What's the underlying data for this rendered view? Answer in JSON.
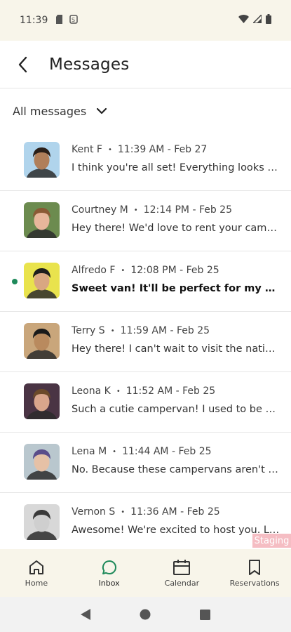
{
  "status_bar": {
    "time": "11:39",
    "icons": [
      "sd-card-icon",
      "sim-icon",
      "wifi-icon",
      "signal-icon",
      "battery-icon"
    ]
  },
  "app_bar": {
    "title": "Messages"
  },
  "filter": {
    "label": "All messages"
  },
  "messages": [
    {
      "name": "Kent F",
      "time": "11:39 AM - Feb 27",
      "preview": "I think you're all set! Everything looks go...",
      "unread": false,
      "avatar_bg": "#b0d4ec",
      "skin": "#b07f5a",
      "hair": "#2a1f18"
    },
    {
      "name": "Courtney M",
      "time": "12:14 PM - Feb 25",
      "preview": "Hey there! We'd love to rent your campe...",
      "unread": false,
      "avatar_bg": "#6c8b4f",
      "skin": "#e7b69b",
      "hair": "#8a5a35"
    },
    {
      "name": "Alfredo F",
      "time": "12:08 PM - Feb 25",
      "preview": "Sweet van! It'll be perfect for my and my...",
      "unread": true,
      "avatar_bg": "#e9e34d",
      "skin": "#d9a782",
      "hair": "#1d1d1d"
    },
    {
      "name": "Terry S",
      "time": "11:59 AM - Feb 25",
      "preview": "Hey there! I can't wait to visit the nationa...",
      "unread": false,
      "avatar_bg": "#c9a67b",
      "skin": "#b98a5e",
      "hair": "#1a1a1a"
    },
    {
      "name": "Leona K",
      "time": "11:52 AM - Feb 25",
      "preview": "Such a cutie campervan! I used to be a f...",
      "unread": false,
      "avatar_bg": "#4a3444",
      "skin": "#d9a68c",
      "hair": "#6b4a2a"
    },
    {
      "name": "Lena M",
      "time": "11:44 AM - Feb 25",
      "preview": "No. Because these campervans aren't m...",
      "unread": false,
      "avatar_bg": "#b9c7ce",
      "skin": "#e6c1a6",
      "hair": "#5b4d8a"
    },
    {
      "name": "Vernon S",
      "time": "11:36 AM - Feb 25",
      "preview": "Awesome! We're excited to host you. Let...",
      "unread": false,
      "avatar_bg": "#d8d8d8",
      "skin": "#cfcfcf",
      "hair": "#3a3a3a"
    }
  ],
  "staging_label": "Staging",
  "bottom_nav": [
    {
      "label": "Home",
      "icon": "home-icon",
      "active": false
    },
    {
      "label": "Inbox",
      "icon": "chat-bubble-icon",
      "active": true
    },
    {
      "label": "Calendar",
      "icon": "calendar-icon",
      "active": false
    },
    {
      "label": "Reservations",
      "icon": "bookmark-icon",
      "active": false
    }
  ],
  "colors": {
    "accent": "#1f8a5b",
    "header_bg": "#f8f5ea",
    "divider": "#e6e6e6"
  }
}
